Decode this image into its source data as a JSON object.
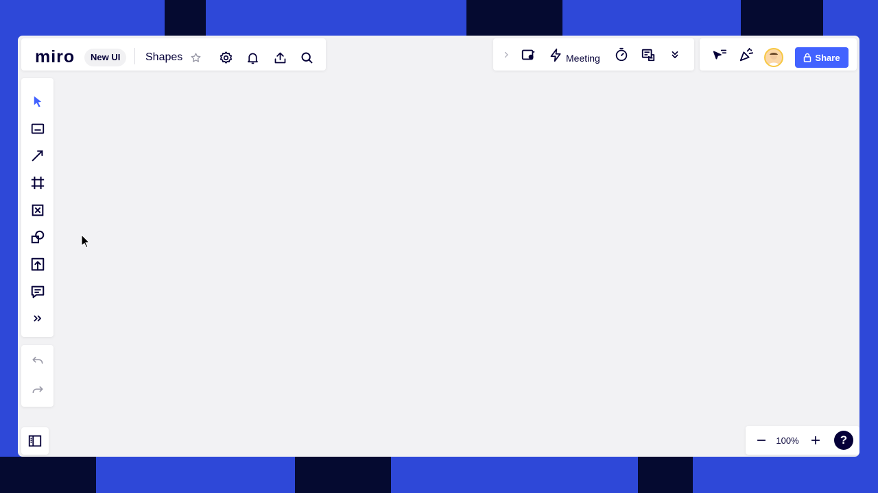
{
  "brand": {
    "logo_text": "miro",
    "ui_badge": "New UI"
  },
  "board": {
    "title": "Shapes"
  },
  "top_left_toolbar": {
    "icons": [
      "star-icon",
      "settings-icon",
      "bell-icon",
      "upload-icon",
      "search-icon"
    ]
  },
  "collab_toolbar": {
    "icons": [
      "chevron-right-icon",
      "present-icon",
      "lightning-icon",
      "timer-icon",
      "voting-icon",
      "double-chevron-down-icon"
    ],
    "meeting_label": "Meeting"
  },
  "share_panel": {
    "share_label": "Share",
    "icons": [
      "cursor-filter-icon",
      "celebration-icon",
      "avatar",
      "lock-icon"
    ]
  },
  "left_toolbar": {
    "tools": [
      "select-icon",
      "text-icon",
      "connection-line-icon",
      "frame-icon",
      "sticky-note-icon",
      "shapes-icon",
      "upload-icon",
      "comment-icon",
      "more-tools-icon"
    ],
    "history": [
      "undo-icon",
      "redo-icon"
    ]
  },
  "zoom": {
    "level": "100%",
    "help_label": "?"
  },
  "colors": {
    "accent": "#4262ff",
    "ink": "#050038",
    "canvas": "#f2f2f4",
    "background": "#2e48d8"
  }
}
